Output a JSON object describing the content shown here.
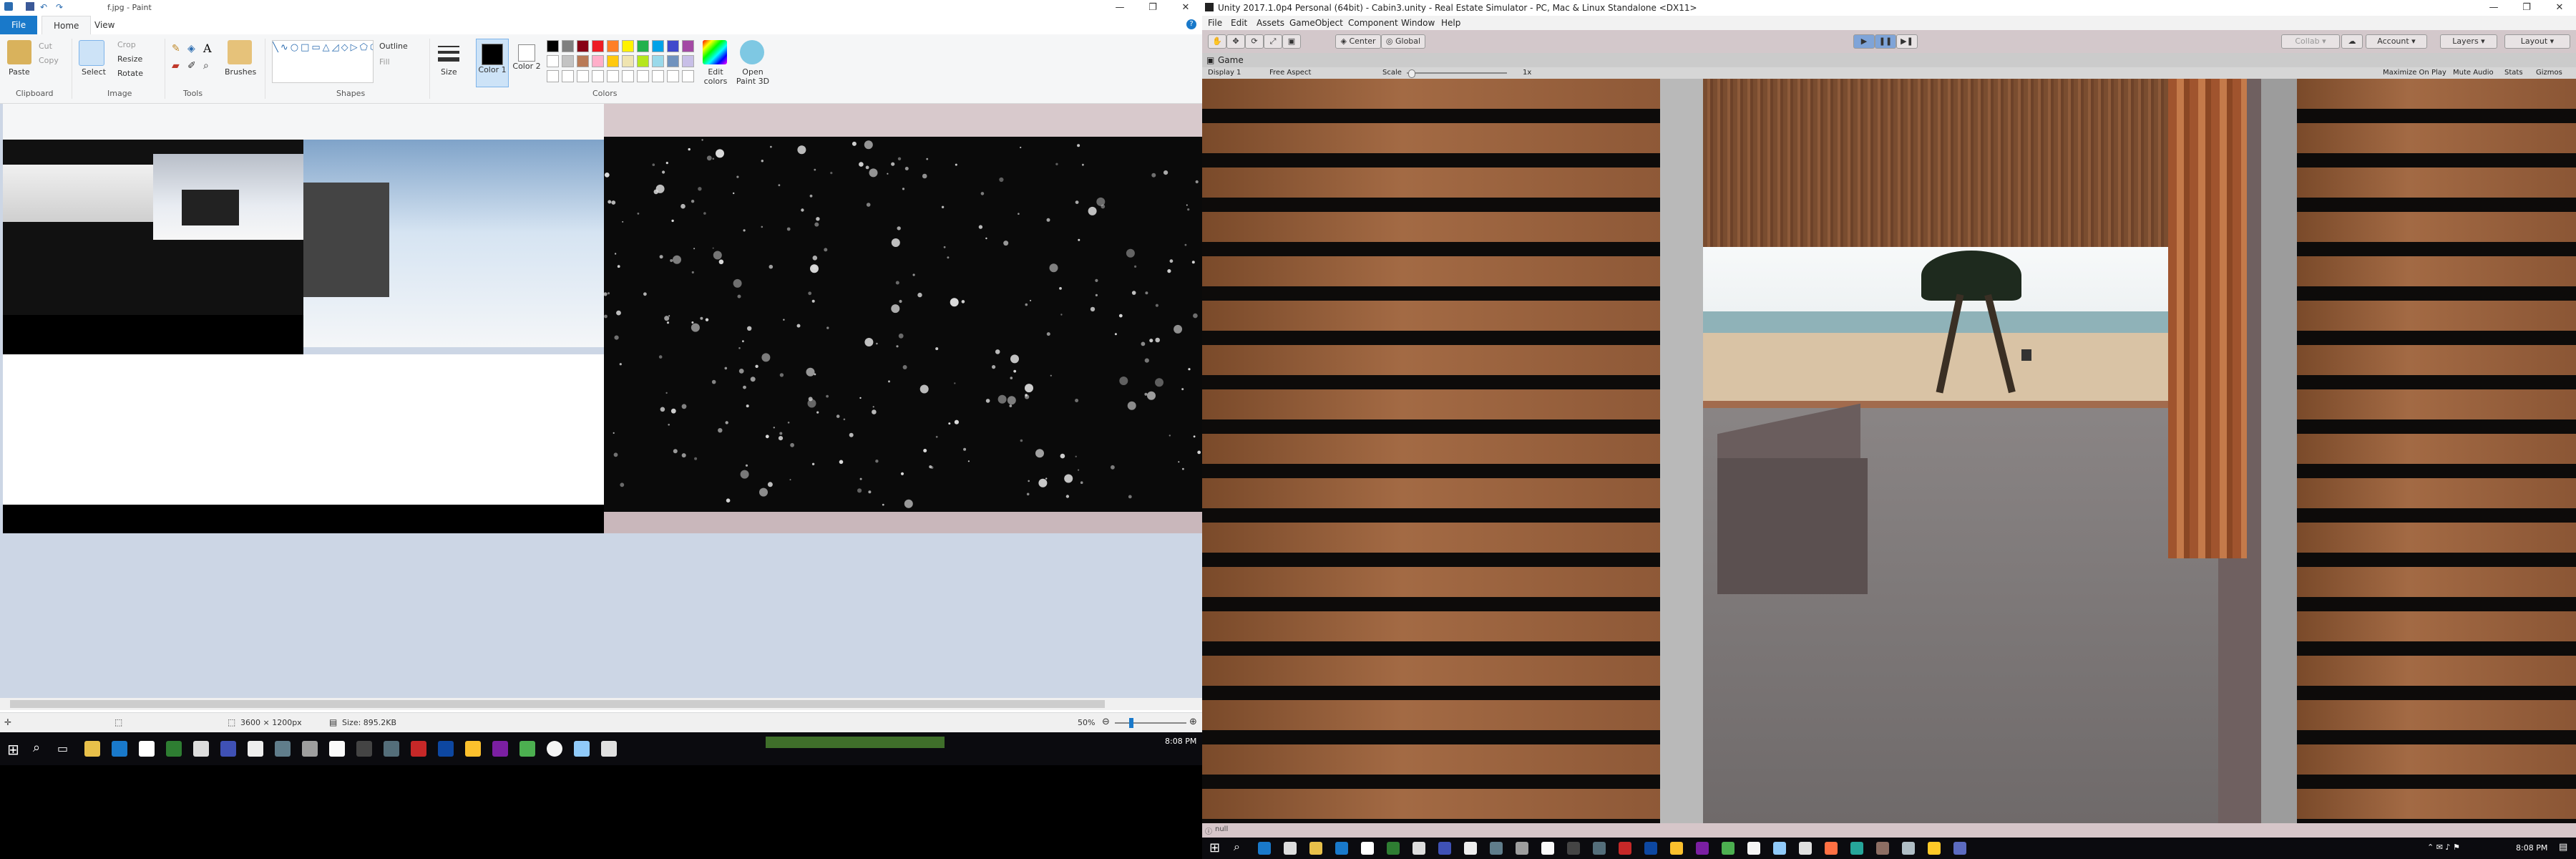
{
  "paint": {
    "title": "f.jpg - Paint",
    "tabs": [
      "File",
      "Home",
      "View"
    ],
    "clipboard": {
      "paste": "Paste",
      "cut": "Cut",
      "copy": "Copy",
      "label": "Clipboard"
    },
    "image": {
      "select": "Select",
      "crop": "Crop",
      "resize": "Resize",
      "rotate": "Rotate",
      "label": "Image"
    },
    "tools": {
      "label": "Tools",
      "brushes": "Brushes"
    },
    "shapes": {
      "outline": "Outline",
      "fill": "Fill",
      "label": "Shapes"
    },
    "size_label": "Size",
    "color1": "Color 1",
    "color2": "Color 2",
    "colors_label": "Colors",
    "edit_colors": "Edit colors",
    "open_paint3d": "Open Paint 3D",
    "status": {
      "dimensions": "3600 × 1200px",
      "size": "Size: 895.2KB",
      "zoom": "50%"
    },
    "palette": [
      "#000000",
      "#7f7f7f",
      "#880015",
      "#ed1c24",
      "#ff7f27",
      "#fff200",
      "#22b14c",
      "#00a2e8",
      "#3f48cc",
      "#a349a4",
      "#ffffff",
      "#c3c3c3",
      "#b97a57",
      "#ffaec9",
      "#ffc90e",
      "#efe4b0",
      "#b5e61d",
      "#99d9ea",
      "#7092be",
      "#c8bfe7"
    ]
  },
  "taskbar_left": {
    "clock": "8:08 PM"
  },
  "unity": {
    "title": "Unity 2017.1.0p4 Personal (64bit) - Cabin3.unity - Real Estate Simulator - PC, Mac & Linux Standalone <DX11>",
    "menu": [
      "File",
      "Edit",
      "Assets",
      "GameObject",
      "Component",
      "Window",
      "Help"
    ],
    "toolbar": {
      "center": "Center",
      "global": "Global",
      "collab": "Collab",
      "account": "Account",
      "layers": "Layers",
      "layout": "Layout"
    },
    "game_tab": "Game",
    "gamebar": {
      "display": "Display 1",
      "aspect": "Free Aspect",
      "scale": "Scale",
      "scale_value": "1x",
      "maximize": "Maximize On Play",
      "mute": "Mute Audio",
      "stats": "Stats",
      "gizmos": "Gizmos"
    },
    "console": "null",
    "clock": "8:08 PM"
  }
}
